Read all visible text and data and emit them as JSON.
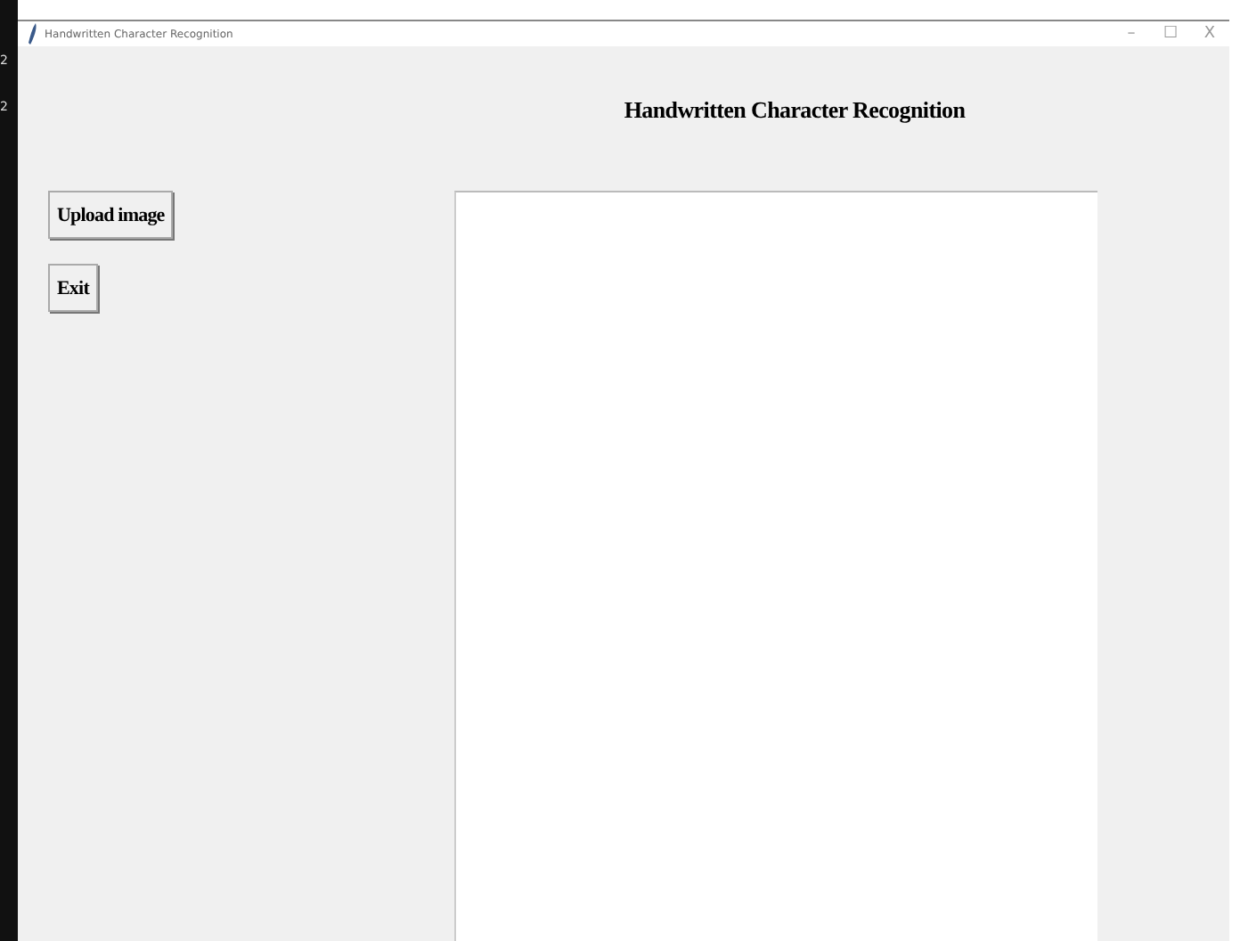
{
  "edge_marks": [
    "2",
    "2"
  ],
  "window": {
    "title": "Handwritten Character Recognition",
    "controls": [
      "–",
      "☐",
      "X"
    ]
  },
  "heading": "Handwritten Character Recognition",
  "buttons": [
    {
      "label": "Upload image"
    },
    {
      "label": "Exit"
    }
  ]
}
